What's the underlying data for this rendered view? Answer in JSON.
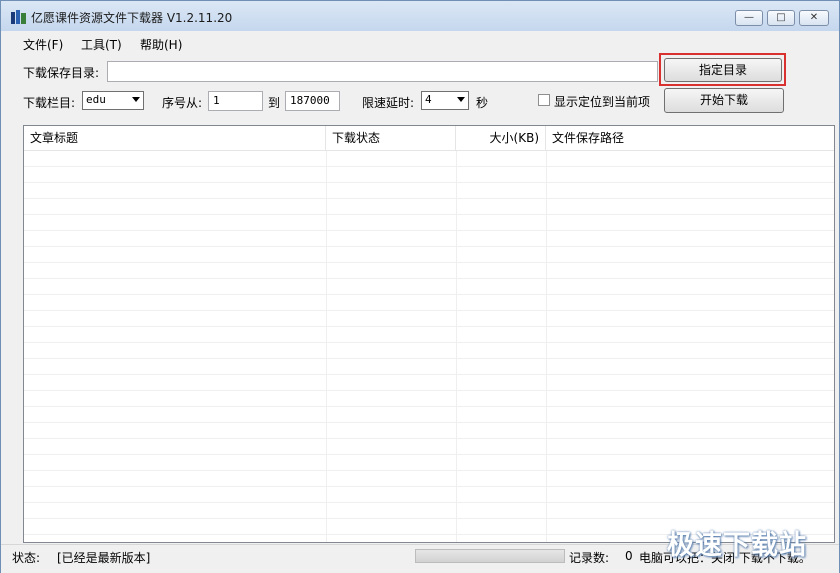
{
  "window": {
    "title": "亿愿课件资源文件下载器 V1.2.11.20",
    "minimize_glyph": "—",
    "maximize_glyph": "□",
    "close_glyph": "✕"
  },
  "menu": [
    "文件(F)",
    "工具(T)",
    "帮助(H)"
  ],
  "form": {
    "save_dir_label": "下载保存目录:",
    "save_dir_value": "",
    "choose_dir_button": "指定目录",
    "column_label": "下载栏目:",
    "column_value": "edu",
    "seq_from_label": "序号从:",
    "seq_from_value": "1",
    "to_label": "到",
    "seq_to_value": "187000",
    "delay_label": "限速延时:",
    "delay_value": "4",
    "seconds_label": "秒",
    "show_current_label": "显示定位到当前项",
    "show_current_checked": false,
    "start_button": "开始下载"
  },
  "table": {
    "columns": [
      "文章标题",
      "下载状态",
      "大小(KB)",
      "文件保存路径"
    ],
    "rows": []
  },
  "status": {
    "label": "状态:",
    "value": "[已经是最新版本]",
    "progress_fraction": 0,
    "records_label": "记录数:",
    "records_value": "0",
    "extra": "电脑可以把：关闭  下载不下载。"
  },
  "watermark": "极速下载站",
  "colors": {
    "highlight": "#d9312f",
    "titlebar": "#c5d7ee"
  }
}
